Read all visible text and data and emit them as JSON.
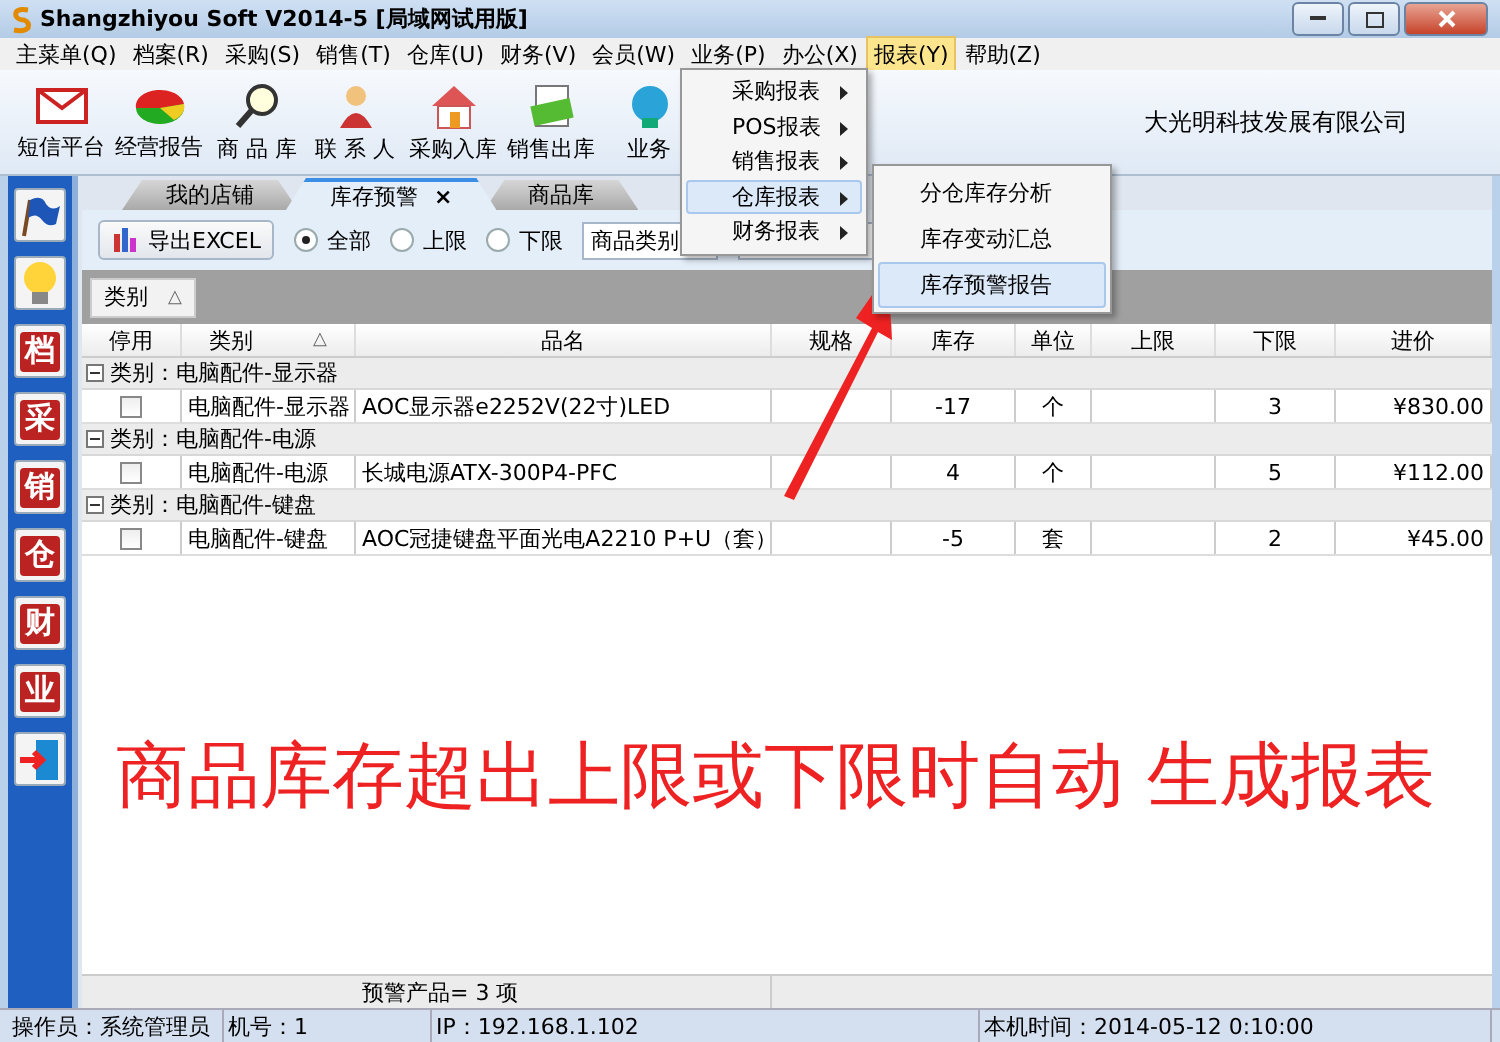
{
  "window": {
    "title": "Shangzhiyou Soft V2014-5 [局域网试用版]"
  },
  "menu_bar": [
    {
      "label": "主菜单(Q)",
      "selected": false
    },
    {
      "label": "档案(R)",
      "selected": false
    },
    {
      "label": "采购(S)",
      "selected": false
    },
    {
      "label": "销售(T)",
      "selected": false
    },
    {
      "label": "仓库(U)",
      "selected": false
    },
    {
      "label": "财务(V)",
      "selected": false
    },
    {
      "label": "会员(W)",
      "selected": false
    },
    {
      "label": "业务(P)",
      "selected": false
    },
    {
      "label": "办公(X)",
      "selected": false
    },
    {
      "label": "报表(Y)",
      "selected": true
    },
    {
      "label": "帮助(Z)",
      "selected": false
    }
  ],
  "toolbar": {
    "buttons": [
      {
        "label": "短信平台",
        "kind": "mail"
      },
      {
        "label": "经营报告",
        "kind": "chart"
      },
      {
        "label": "商 品 库",
        "kind": "search"
      },
      {
        "label": "联 系 人",
        "kind": "contact"
      },
      {
        "label": "采购入库",
        "kind": "house"
      },
      {
        "label": "销售出库",
        "kind": "money"
      },
      {
        "label": "业务",
        "kind": "service"
      }
    ],
    "company": "大光明科技发展有限公司"
  },
  "report_menu": {
    "items": [
      {
        "label": "采购报表",
        "selected": false
      },
      {
        "label": "POS报表",
        "selected": false
      },
      {
        "label": "销售报表",
        "selected": false
      },
      {
        "label": "仓库报表",
        "selected": true
      },
      {
        "label": "财务报表",
        "selected": false
      }
    ]
  },
  "submenu": {
    "items": [
      {
        "label": "分仓库存分析",
        "selected": false
      },
      {
        "label": "库存变动汇总",
        "selected": false
      },
      {
        "label": "库存预警报告",
        "selected": true
      }
    ]
  },
  "sidebar": {
    "items": [
      {
        "kind": "flag"
      },
      {
        "kind": "bulb"
      },
      {
        "kind": "stamp",
        "label": "档"
      },
      {
        "kind": "stamp",
        "label": "采"
      },
      {
        "kind": "stamp",
        "label": "销"
      },
      {
        "kind": "stamp",
        "label": "仓"
      },
      {
        "kind": "stamp",
        "label": "财"
      },
      {
        "kind": "stamp",
        "label": "业"
      },
      {
        "kind": "exit"
      }
    ]
  },
  "tabs": [
    {
      "label": "我的店铺",
      "selected": false
    },
    {
      "label": "库存预警",
      "selected": true,
      "close": "×"
    },
    {
      "label": "商品库",
      "selected": false
    }
  ],
  "filter": {
    "export_button": "导出EXCEL",
    "radios": [
      {
        "label": "全部",
        "selected": true
      },
      {
        "label": "上限",
        "selected": false
      },
      {
        "label": "下限",
        "selected": false
      }
    ],
    "category_select": "商品类别"
  },
  "group_panel": {
    "chip": "类别",
    "sort": "△"
  },
  "grid": {
    "columns": [
      {
        "label": "停用"
      },
      {
        "label": "类别",
        "sort": "△"
      },
      {
        "label": "品名"
      },
      {
        "label": "规格"
      },
      {
        "label": "库存"
      },
      {
        "label": "单位"
      },
      {
        "label": "上限"
      },
      {
        "label": "下限"
      },
      {
        "label": "进价"
      }
    ],
    "groups": [
      {
        "label": "类别：电脑配件-显示器",
        "expanded": true,
        "rows": [
          {
            "disabled": false,
            "category": "电脑配件-显示器",
            "name": "AOC显示器e2252V(22寸)LED",
            "stock": "-17",
            "unit": "个",
            "lower": "3",
            "price": "¥830.00"
          }
        ]
      },
      {
        "label": "类别：电脑配件-电源",
        "expanded": true,
        "rows": [
          {
            "disabled": false,
            "category": "电脑配件-电源",
            "name": "长城电源ATX-300P4-PFC",
            "stock": "4",
            "unit": "个",
            "lower": "5",
            "price": "¥112.00"
          }
        ]
      },
      {
        "label": "类别：电脑配件-键盘",
        "expanded": true,
        "rows": [
          {
            "disabled": false,
            "category": "电脑配件-键盘",
            "name": "AOC冠捷键盘平面光电A2210 P+U（套）",
            "stock": "-5",
            "unit": "套",
            "lower": "2",
            "price": "¥45.00"
          }
        ]
      }
    ],
    "footer": "预警产品= 3 项"
  },
  "status_bar": [
    {
      "label": "操作员：系统管理员"
    },
    {
      "label": "机号：1"
    },
    {
      "label": "IP：192.168.1.102"
    },
    {
      "label": "本机时间：2014-05-12 0:10:00"
    }
  ],
  "annotation": {
    "caption": "商品库存超出上限或下限时自动 生成报表"
  }
}
